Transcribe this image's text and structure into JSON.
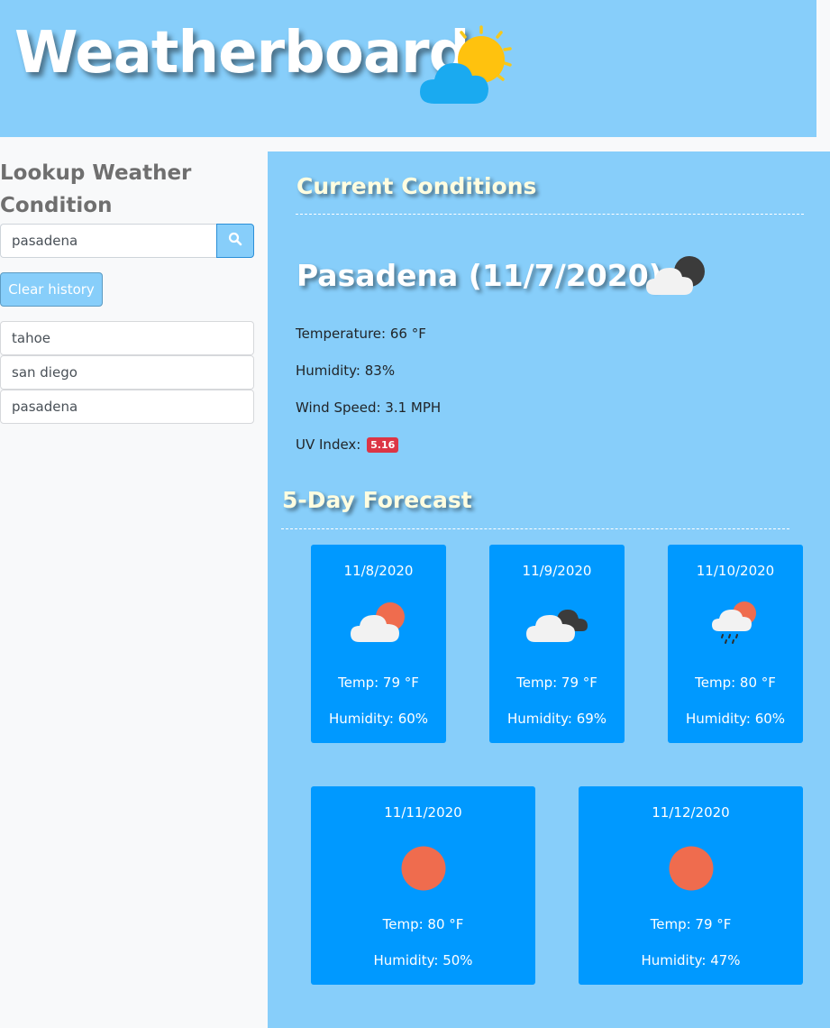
{
  "header": {
    "title": "Weatherboard",
    "icon": "sun-behind-cloud-icon"
  },
  "sidebar": {
    "title": "Lookup Weather Condition",
    "search": {
      "value": "pasadena",
      "placeholder": ""
    },
    "search_icon": "search-icon",
    "clear_label": "Clear history",
    "history": [
      "tahoe",
      "san diego",
      "pasadena"
    ]
  },
  "current": {
    "heading": "Current Conditions",
    "city_title": "Pasadena (11/7/2020)",
    "icon": "night-cloud-icon",
    "temperature": "Temperature: 66 °F",
    "humidity": "Humidity: 83%",
    "wind": "Wind Speed: 3.1 MPH",
    "uv_label": "UV Index:",
    "uv_value": "5.16",
    "uv_color": "#dc3545"
  },
  "forecast": {
    "heading": "5-Day Forecast",
    "days": [
      {
        "date": "11/8/2020",
        "icon": "cloud-sun-icon",
        "temp": "Temp: 79 °F",
        "humidity": "Humidity: 60%"
      },
      {
        "date": "11/9/2020",
        "icon": "broken-clouds-icon",
        "temp": "Temp: 79 °F",
        "humidity": "Humidity: 69%"
      },
      {
        "date": "11/10/2020",
        "icon": "rain-cloud-sun-icon",
        "temp": "Temp: 80 °F",
        "humidity": "Humidity: 60%"
      },
      {
        "date": "11/11/2020",
        "icon": "sun-icon",
        "temp": "Temp: 80 °F",
        "humidity": "Humidity: 50%"
      },
      {
        "date": "11/12/2020",
        "icon": "sun-icon",
        "temp": "Temp: 79 °F",
        "humidity": "Humidity: 47%"
      }
    ]
  },
  "colors": {
    "sky": "#87cefa",
    "card": "#0099ff",
    "heading_text": "#fffde0",
    "sun": "#ef6c4e"
  }
}
